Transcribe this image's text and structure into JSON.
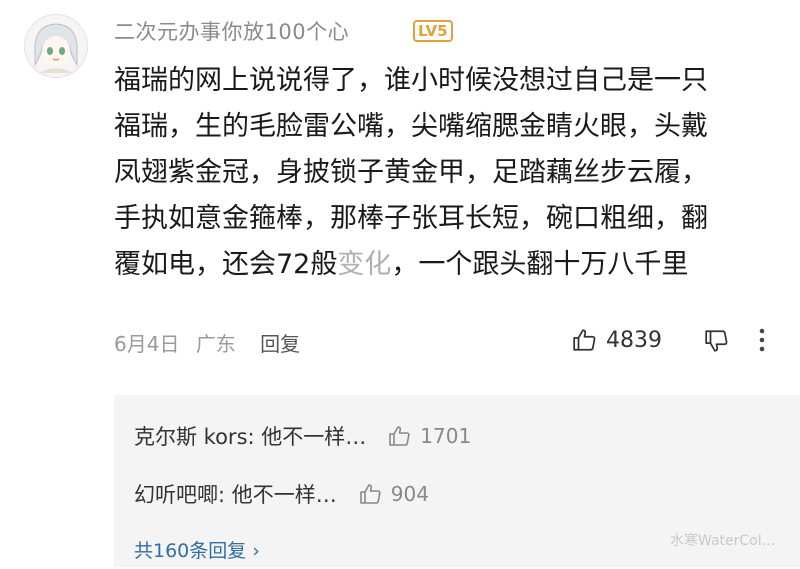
{
  "user": {
    "name": "二次元办事你放100个心",
    "level": "LV5"
  },
  "comment": {
    "lines": [
      "福瑞的网上说说得了，谁小时候没想过自己是一只",
      "福瑞，生的毛脸雷公嘴，尖嘴缩腮金睛火眼，头戴",
      "凤翅紫金冠，身披锁子黄金甲，足踏藕丝步云履，",
      "手执如意金箍棒，那棒子张耳长短，碗口粗细，翻"
    ],
    "last_line_before": "覆如电，还会72般",
    "last_line_highlight": "变化",
    "last_line_after": "，一个跟头翻十万八千里"
  },
  "meta": {
    "date": "6月4日",
    "location": "广东",
    "reply_label": "回复",
    "like_count": "4839"
  },
  "replies": {
    "items": [
      {
        "text": "克尔斯 kors: 他不一样…",
        "likes": "1701"
      },
      {
        "text": "幻听吧唧: 他不一样…",
        "likes": "904"
      }
    ],
    "more_label": "共160条回复 ›"
  },
  "watermark": "水寒WaterCol..."
}
